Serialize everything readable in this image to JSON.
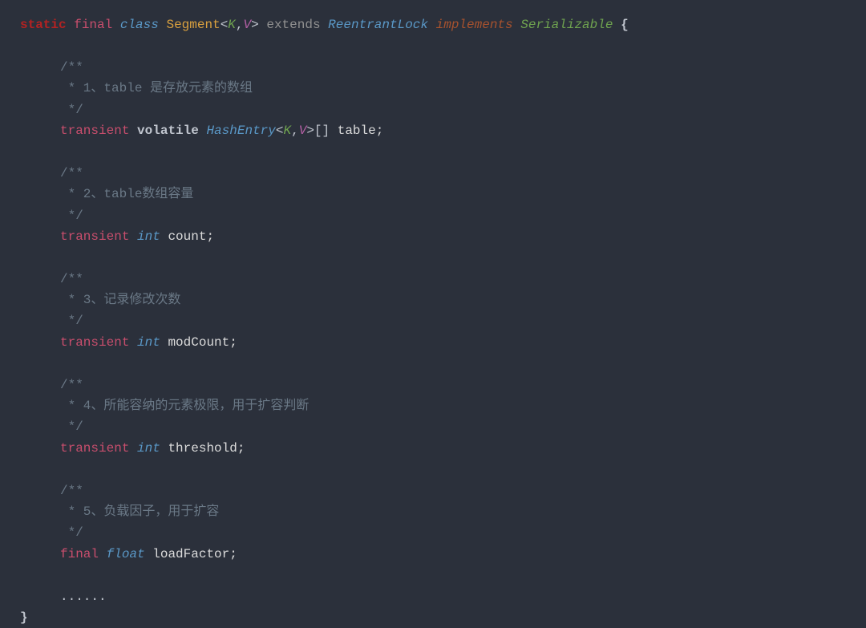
{
  "declaration": {
    "kw_static": "static",
    "kw_final": "final",
    "kw_class": "class",
    "class_name": "Segment",
    "lt": "<",
    "generic_k": "K",
    "comma": ",",
    "generic_v": "V",
    "gt": ">",
    "kw_extends": "extends",
    "super_class": "ReentrantLock",
    "kw_implements": "implements",
    "interface": "Serializable",
    "open_brace": "{"
  },
  "block1": {
    "c1": "/**",
    "c2": " * 1、table 是存放元素的数组",
    "c3": " */",
    "kw_transient": "transient",
    "kw_volatile": "volatile",
    "type": "HashEntry",
    "lt": "<",
    "generic_k": "K",
    "comma": ",",
    "generic_v": "V",
    "gt": ">",
    "brackets": "[]",
    "var": " table;"
  },
  "block2": {
    "c1": "/**",
    "c2": " * 2、table数组容量",
    "c3": " */",
    "kw_transient": "transient",
    "kw_int": "int",
    "var": " count;"
  },
  "block3": {
    "c1": "/**",
    "c2": " * 3、记录修改次数",
    "c3": " */",
    "kw_transient": "transient",
    "kw_int": "int",
    "var": " modCount;"
  },
  "block4": {
    "c1": "/**",
    "c2": " * 4、所能容纳的元素极限，用于扩容判断",
    "c3": " */",
    "kw_transient": "transient",
    "kw_int": "int",
    "var": " threshold;"
  },
  "block5": {
    "c1": "/**",
    "c2": " * 5、负载因子，用于扩容",
    "c3": " */",
    "kw_final": "final",
    "kw_float": "float",
    "var": " loadFactor;"
  },
  "ellipsis": "......",
  "close_brace": "}"
}
